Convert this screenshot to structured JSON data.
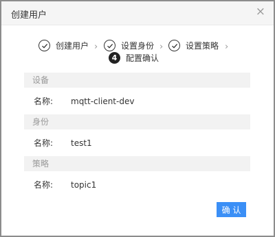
{
  "dialog": {
    "title": "创建用户",
    "close_glyph": "×"
  },
  "steps": [
    {
      "label": "创建用户",
      "status": "done"
    },
    {
      "label": "设置身份",
      "status": "done"
    },
    {
      "label": "设置策略",
      "status": "done"
    },
    {
      "label": "配置确认",
      "status": "current",
      "number": "4"
    }
  ],
  "step_separator": "›",
  "sections": [
    {
      "header": "设备",
      "field_label": "名称:",
      "value": "mqtt-client-dev"
    },
    {
      "header": "身份",
      "field_label": "名称:",
      "value": "test1"
    },
    {
      "header": "策略",
      "field_label": "名称:",
      "value": "topic1"
    }
  ],
  "confirm_label": "确 认",
  "colors": {
    "primary": "#3b8ff6",
    "section_bg": "#f2f2f2",
    "overlay": "#8c8c8c"
  }
}
